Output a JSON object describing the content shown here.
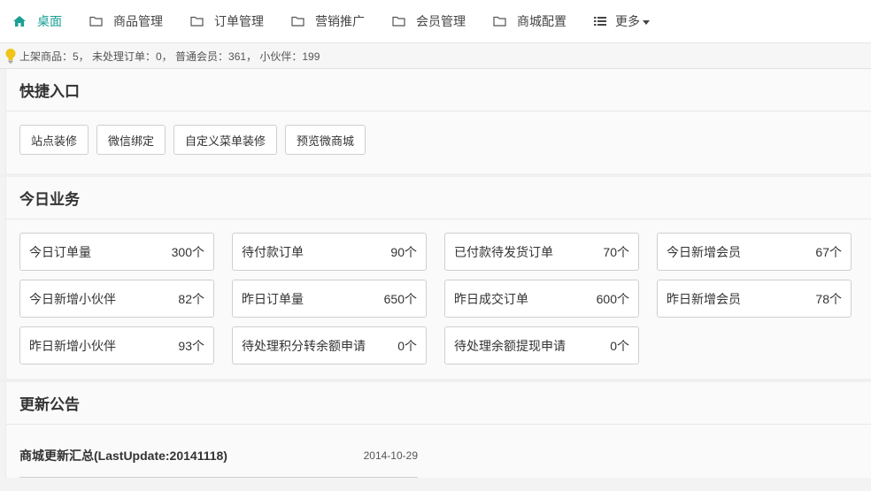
{
  "nav": {
    "items": [
      {
        "label": "桌面",
        "icon": "home-icon",
        "active": true
      },
      {
        "label": "商品管理",
        "icon": "folder-icon"
      },
      {
        "label": "订单管理",
        "icon": "folder-icon"
      },
      {
        "label": "营销推广",
        "icon": "folder-icon"
      },
      {
        "label": "会员管理",
        "icon": "folder-icon"
      },
      {
        "label": "商城配置",
        "icon": "folder-icon"
      },
      {
        "label": "更多",
        "icon": "list-icon",
        "dropdown": true
      }
    ]
  },
  "infobar": {
    "icon": "lightbulb-icon",
    "text": "上架商品：5， 未处理订单：0， 普通会员：361， 小伙伴：199"
  },
  "quick": {
    "title": "快捷入口",
    "buttons": [
      "站点装修",
      "微信绑定",
      "自定义菜单装修",
      "预览微商城"
    ]
  },
  "today": {
    "title": "今日业务",
    "stats": [
      {
        "label": "今日订单量",
        "value": "300个"
      },
      {
        "label": "待付款订单",
        "value": "90个"
      },
      {
        "label": "已付款待发货订单",
        "value": "70个"
      },
      {
        "label": "今日新增会员",
        "value": "67个"
      },
      {
        "label": "今日新增小伙伴",
        "value": "82个"
      },
      {
        "label": "昨日订单量",
        "value": "650个"
      },
      {
        "label": "昨日成交订单",
        "value": "600个"
      },
      {
        "label": "昨日新增会员",
        "value": "78个"
      },
      {
        "label": "昨日新增小伙伴",
        "value": "93个"
      },
      {
        "label": "待处理积分转余额申请",
        "value": "0个"
      },
      {
        "label": "待处理余额提现申请",
        "value": "0个"
      }
    ]
  },
  "notices": {
    "title": "更新公告",
    "items": [
      {
        "title": "商城更新汇总(LastUpdate:20141118)",
        "date": "2014-10-29"
      }
    ]
  },
  "colors": {
    "accent": "#1aa094",
    "bulb": "#f0c419"
  }
}
